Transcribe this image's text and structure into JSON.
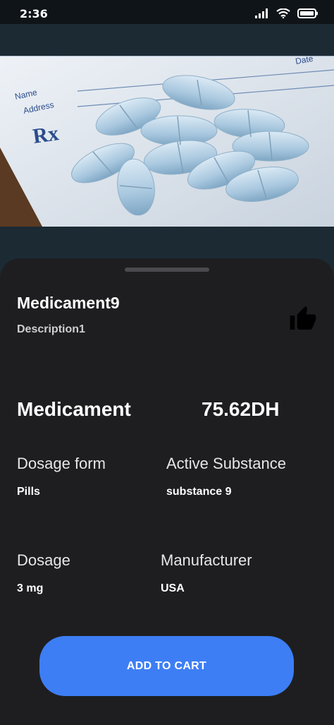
{
  "status_bar": {
    "time": "2:36"
  },
  "hero_image": {
    "paper_labels": {
      "name": "Name",
      "address": "Address",
      "date": "Date",
      "rx": "Rx"
    }
  },
  "product": {
    "name": "Medicament9",
    "description": "Description1",
    "category": "Medicament",
    "price": "75.62DH"
  },
  "details": {
    "dosage_form": {
      "label": "Dosage form",
      "value": "Pills"
    },
    "active_substance": {
      "label": "Active Substance",
      "value": "substance 9"
    },
    "dosage": {
      "label": "Dosage",
      "value": "3 mg"
    },
    "manufacturer": {
      "label": "Manufacturer",
      "value": "USA"
    }
  },
  "actions": {
    "add_to_cart": "ADD TO CART"
  },
  "icons": [
    "signal-icon",
    "wifi-icon",
    "battery-icon",
    "thumbs-up-icon"
  ],
  "colors": {
    "accent": "#3d7ef5",
    "sheet": "#1e1e20",
    "background": "#1c2a33"
  }
}
